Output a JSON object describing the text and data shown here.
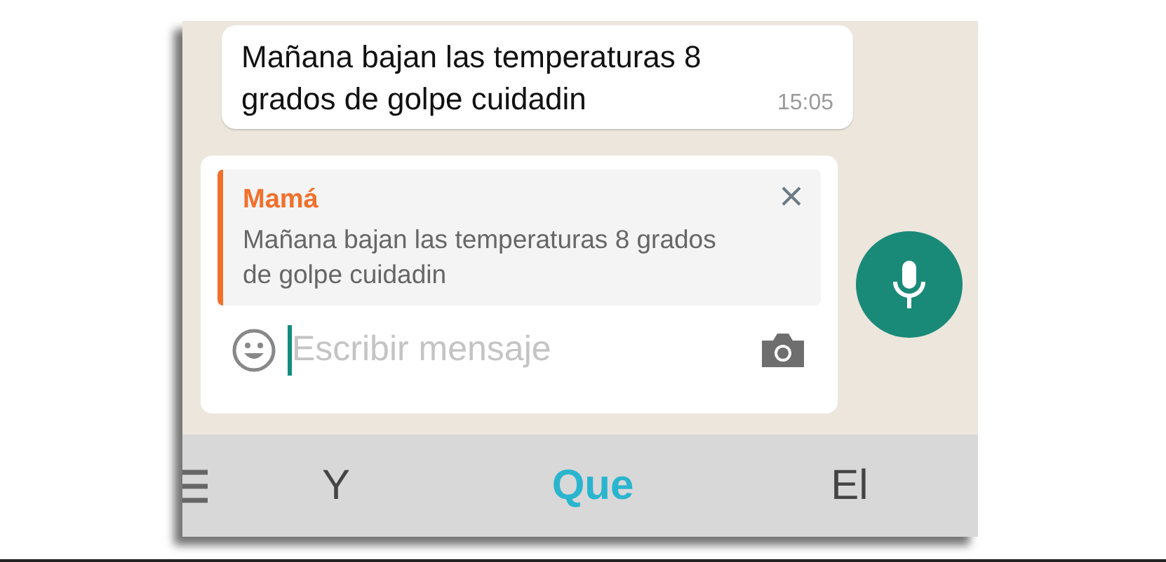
{
  "message": {
    "text": "Mañana bajan las temperaturas 8 grados de golpe cuidadin",
    "time": "15:05"
  },
  "reply_preview": {
    "sender": "Mamá",
    "text": "Mañana bajan las temperaturas 8 grados de golpe cuidadin"
  },
  "composer": {
    "placeholder": "Escribir mensaje"
  },
  "suggestions": [
    {
      "label": "Y",
      "selected": false
    },
    {
      "label": "Que",
      "selected": true
    },
    {
      "label": "El",
      "selected": false
    }
  ]
}
